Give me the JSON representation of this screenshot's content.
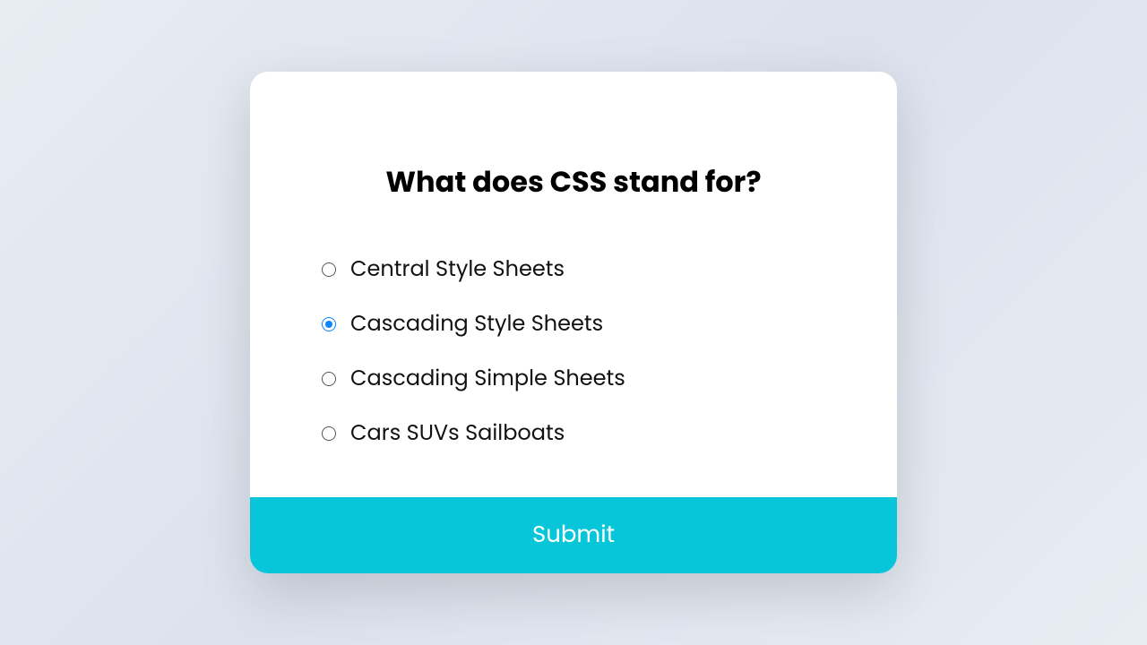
{
  "quiz": {
    "question": "What does CSS stand for?",
    "options": [
      {
        "label": "Central Style Sheets",
        "selected": false
      },
      {
        "label": "Cascading Style Sheets",
        "selected": true
      },
      {
        "label": "Cascading Simple Sheets",
        "selected": false
      },
      {
        "label": "Cars SUVs Sailboats",
        "selected": false
      }
    ],
    "submit_label": "Submit"
  },
  "colors": {
    "accent": "#08c6d9",
    "radio_selected": "#0a84ff"
  }
}
